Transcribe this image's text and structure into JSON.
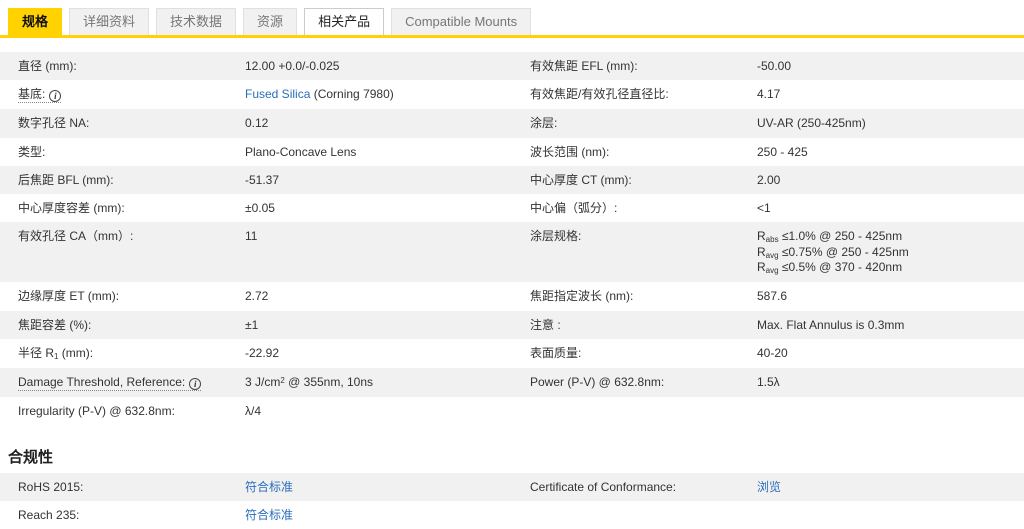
{
  "colors": {
    "accent_yellow": "#ffd200",
    "row_alt_bg": "#f1f1f2",
    "link_blue": "#2a6ebb",
    "text": "#333333"
  },
  "icons": {
    "info": "i"
  },
  "tabs": [
    {
      "label": "规格",
      "style": "active"
    },
    {
      "label": "详细资料",
      "style": "inactive"
    },
    {
      "label": "技术数据",
      "style": "inactive"
    },
    {
      "label": "资源",
      "style": "inactive"
    },
    {
      "label": "相关产品",
      "style": "plain"
    },
    {
      "label": "Compatible Mounts",
      "style": "inactive"
    }
  ],
  "spec_table": {
    "rows": [
      {
        "left": {
          "label": "直径 (mm):",
          "value": "12.00 +0.0/-0.025"
        },
        "right": {
          "label": "有效焦距 EFL (mm):",
          "value": "-50.00"
        }
      },
      {
        "left": {
          "label": "基底:",
          "info": true,
          "link_text": "Fused Silica",
          "value": " (Corning 7980)"
        },
        "right": {
          "label": "有效焦距/有效孔径直径比:",
          "value": "4.17"
        }
      },
      {
        "left": {
          "label": "数字孔径 NA:",
          "value": "0.12"
        },
        "right": {
          "label": "涂层:",
          "value": "UV-AR (250-425nm)"
        }
      },
      {
        "left": {
          "label": "类型:",
          "value": "Plano-Concave Lens"
        },
        "right": {
          "label": "波长范围 (nm):",
          "value": "250 - 425"
        }
      },
      {
        "left": {
          "label": "后焦距 BFL (mm):",
          "value": "-51.37"
        },
        "right": {
          "label": "中心厚度 CT (mm):",
          "value": "2.00"
        }
      },
      {
        "left": {
          "label": "中心厚度容差 (mm):",
          "value": "±0.05"
        },
        "right": {
          "label": "中心偏（弧分）:",
          "value": "<1"
        }
      },
      {
        "left": {
          "label": "有效孔径 CA（mm）:",
          "value": "11"
        },
        "tall": true,
        "right": {
          "label": "涂层规格:",
          "value_html": "R<sub>abs</sub> ≤1.0% @ 250 - 425nm<br>R<sub>avg</sub> ≤0.75% @ 250 - 425nm<br>R<sub>avg</sub> ≤0.5% @ 370 - 420nm"
        }
      },
      {
        "left": {
          "label": "边缘厚度 ET (mm):",
          "value": "2.72"
        },
        "right": {
          "label": "焦距指定波长 (nm):",
          "value": "587.6"
        }
      },
      {
        "left": {
          "label": "焦距容差 (%):",
          "value": "±1"
        },
        "right": {
          "label": "注意 :",
          "value": "Max. Flat Annulus is 0.3mm"
        }
      },
      {
        "left": {
          "label_html": "半径 R<sub>1</sub> (mm):",
          "value": "-22.92"
        },
        "right": {
          "label": "表面质量:",
          "value": "40-20"
        }
      },
      {
        "left": {
          "label": "Damage Threshold, Reference:",
          "info": true,
          "value_html": "3 J/cm<sup>2</sup> @ 355nm, 10ns"
        },
        "right": {
          "label": "Power (P-V) @ 632.8nm:",
          "value": "1.5λ"
        }
      },
      {
        "left": {
          "label": "Irregularity (P-V) @ 632.8nm:",
          "value": "λ/4"
        },
        "right": null
      }
    ]
  },
  "compliance": {
    "heading": "合规性",
    "rows": [
      {
        "left": {
          "label": "RoHS 2015:",
          "link_value": "符合标准"
        },
        "right": {
          "label": "Certificate of Conformance:",
          "link_value": "浏览"
        }
      },
      {
        "left": {
          "label": "Reach 235:",
          "link_value": "符合标准"
        },
        "right": null
      }
    ]
  }
}
